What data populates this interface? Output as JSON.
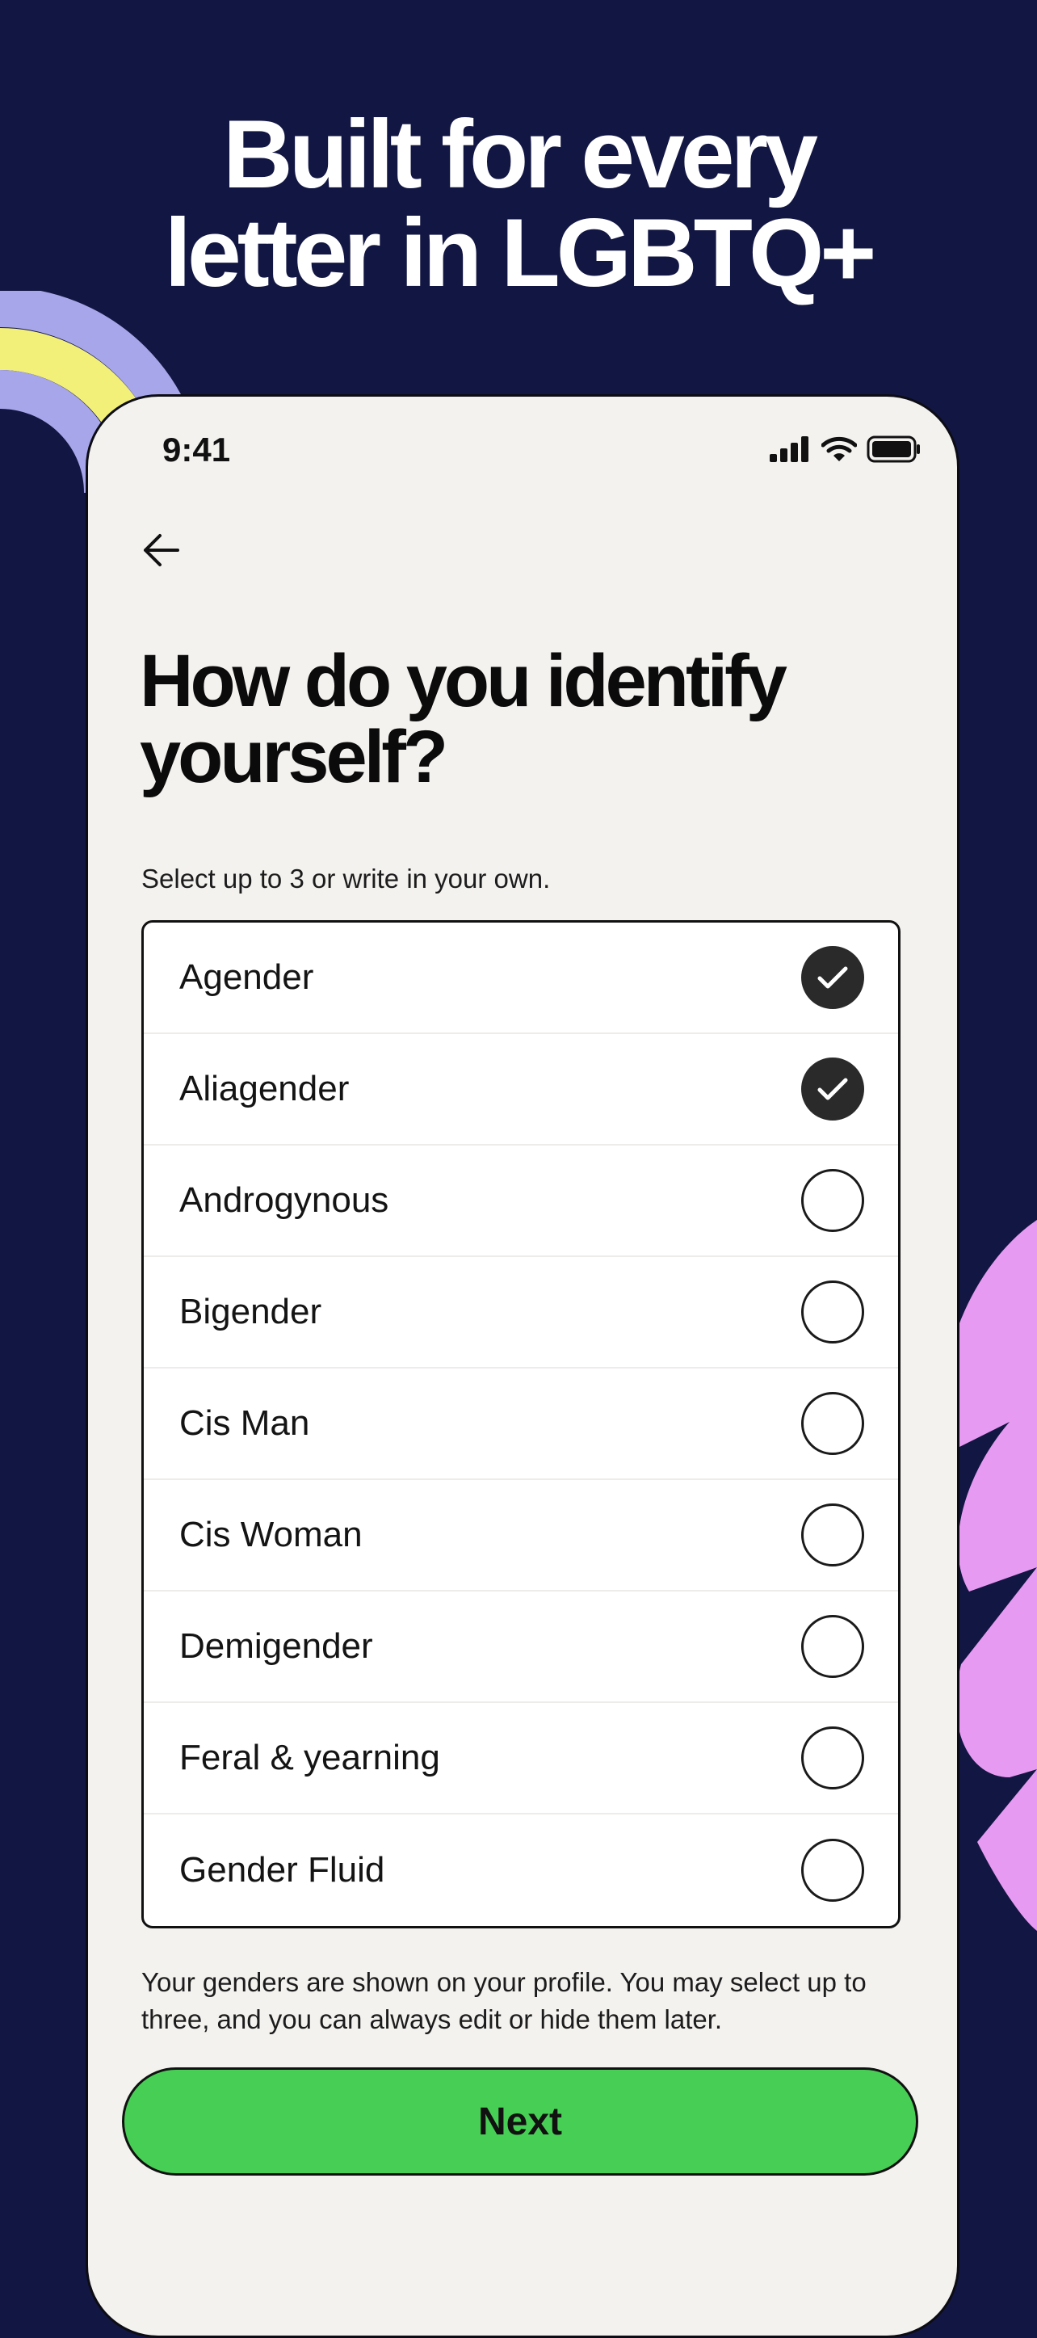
{
  "hero": {
    "line1": "Built for every",
    "line2": "letter in LGBTQ+"
  },
  "status_bar": {
    "time": "9:41",
    "icons": [
      "cellular-signal-icon",
      "wifi-icon",
      "battery-icon"
    ]
  },
  "nav": {
    "back_icon": "arrow-left-icon"
  },
  "question": {
    "title_line1": "How do you identify",
    "title_line2": "yourself?",
    "subtitle": "Select up to 3 or write in your own."
  },
  "options": [
    {
      "label": "Agender",
      "selected": true
    },
    {
      "label": "Aliagender",
      "selected": true
    },
    {
      "label": "Androgynous",
      "selected": false
    },
    {
      "label": "Bigender",
      "selected": false
    },
    {
      "label": "Cis Man",
      "selected": false
    },
    {
      "label": "Cis Woman",
      "selected": false
    },
    {
      "label": "Demigender",
      "selected": false
    },
    {
      "label": "Feral & yearning",
      "selected": false
    },
    {
      "label": "Gender Fluid",
      "selected": false
    }
  ],
  "footnote": "Your genders are shown on your profile. You may select up to three, and you can always edit or hide them later.",
  "next_button": {
    "label": "Next"
  },
  "colors": {
    "background": "#121642",
    "card": "#f4f2ef",
    "accent_green": "#47cf55",
    "deco_lavender": "#a8a6ea",
    "deco_yellow": "#f3f07a",
    "deco_pink": "#e79af2"
  }
}
